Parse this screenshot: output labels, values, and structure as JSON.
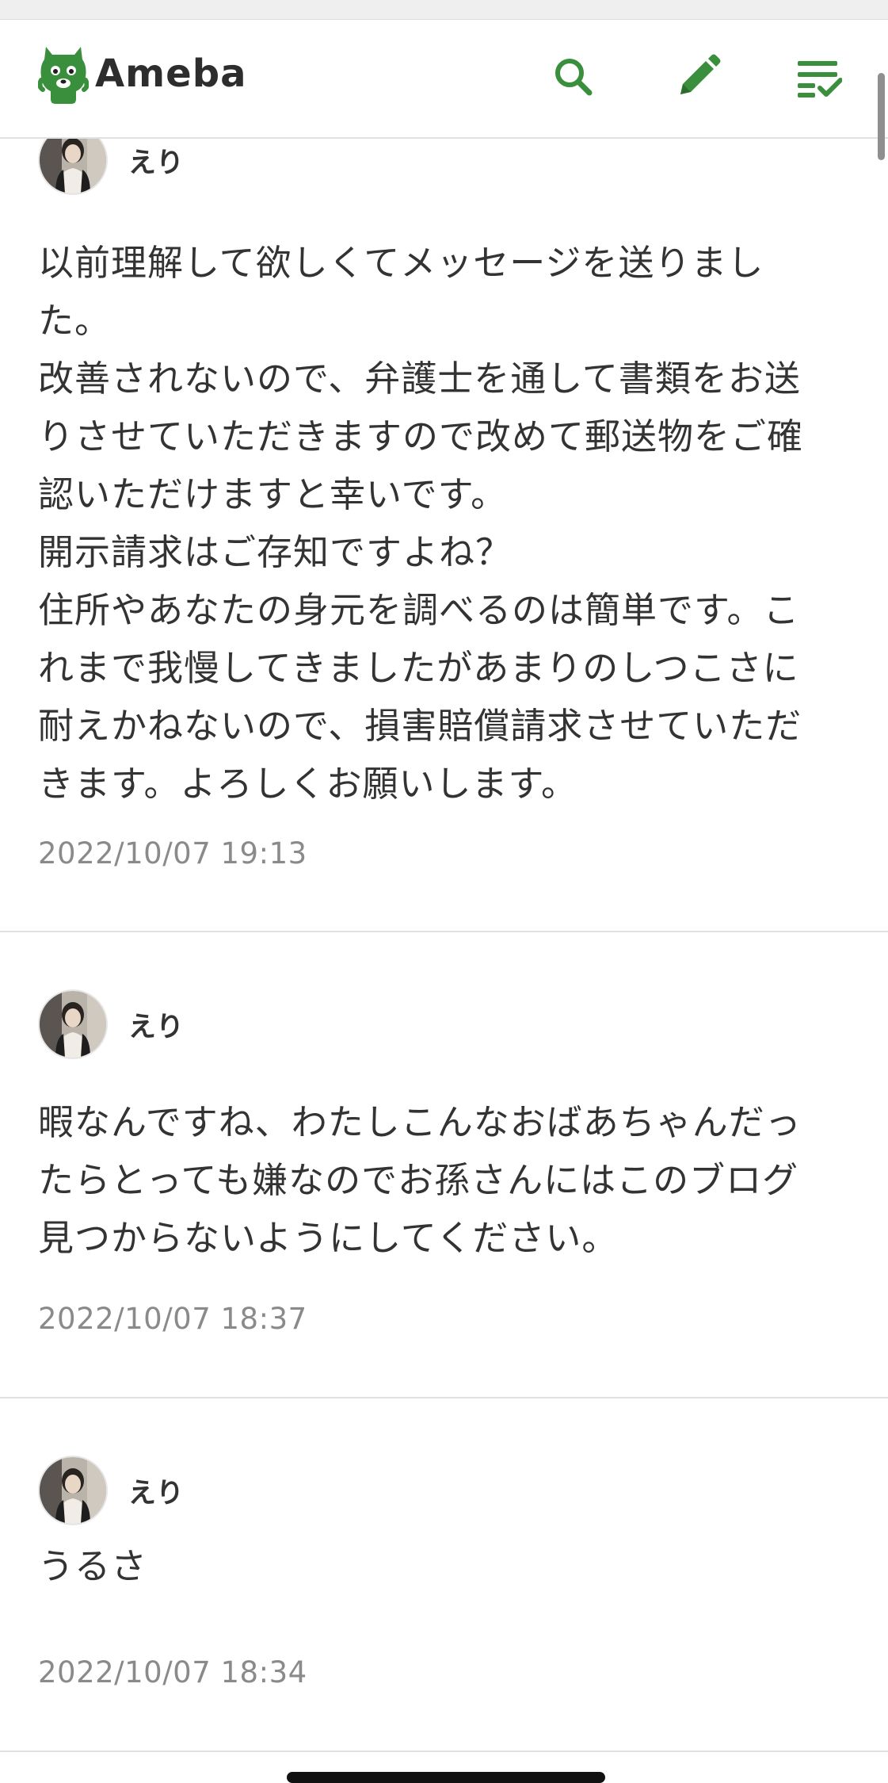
{
  "header": {
    "logo_text": "Ameba",
    "brand_color": "#3a8f3c",
    "icons": [
      "search-icon",
      "pencil-icon",
      "checklist-icon"
    ]
  },
  "comments": [
    {
      "author": "えり",
      "body_lines": [
        "以前理解して欲しくてメッセージを送りまし",
        "た。",
        "改善されないので、弁護士を通して書類をお送",
        "りさせていただきますので改めて郵送物をご確",
        "認いただけますと幸いです。",
        "開示請求はご存知ですよね？",
        "住所やあなたの身元を調べるのは簡単です。こ",
        "れまで我慢してきましたがあまりのしつこさに",
        "耐えかねないので、損害賠償請求させていただ",
        "きます。よろしくお願いします。"
      ],
      "date": "2022/10/07 19:13"
    },
    {
      "author": "えり",
      "body_lines": [
        "暇なんですね、わたしこんなおばあちゃんだっ",
        "たらとっても嫌なのでお孫さんにはこのブログ",
        "見つからないようにしてください。"
      ],
      "date": "2022/10/07 18:37"
    },
    {
      "author": "えり",
      "body_lines": [
        "うるさ"
      ],
      "date": "2022/10/07 18:34"
    }
  ]
}
